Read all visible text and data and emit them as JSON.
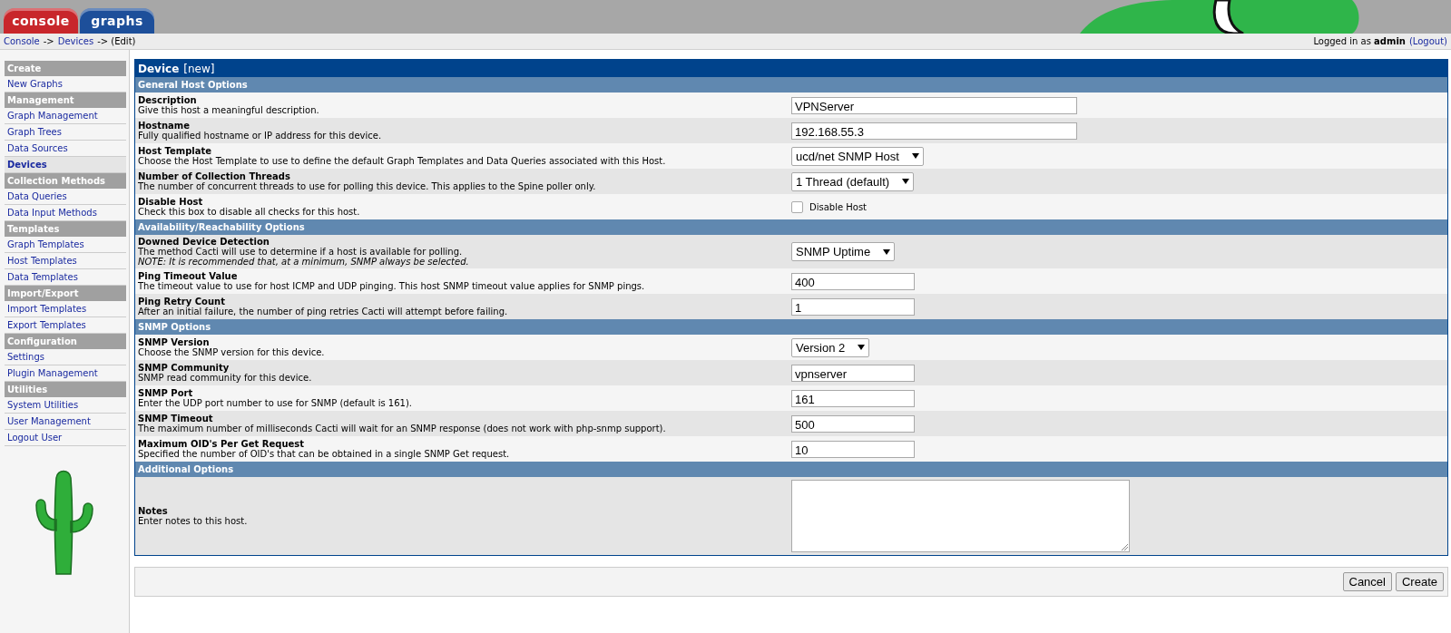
{
  "header": {
    "tabs": [
      {
        "label": "console",
        "color": "#c8262b"
      },
      {
        "label": "graphs",
        "color": "#1d4f9a"
      }
    ]
  },
  "breadcrumb": [
    {
      "label": "Console",
      "kind": "link"
    },
    {
      "label": "->",
      "kind": "text"
    },
    {
      "label": "Devices",
      "kind": "link"
    },
    {
      "label": "-> (Edit)",
      "kind": "text"
    }
  ],
  "user_status": {
    "text": "Logged in as **admin**",
    "link": "(Logout)"
  },
  "sidebar": [
    {
      "title": "Create",
      "items": [
        {
          "label": "New Graphs",
          "selected": false
        }
      ]
    },
    {
      "title": "Management",
      "items": [
        {
          "label": "Graph Management",
          "selected": false
        },
        {
          "label": "Graph Trees",
          "selected": false
        },
        {
          "label": "Data Sources",
          "selected": false
        },
        {
          "label": "Devices",
          "selected": true
        }
      ]
    },
    {
      "title": "Collection Methods",
      "items": [
        {
          "label": "Data Queries",
          "selected": false
        },
        {
          "label": "Data Input Methods",
          "selected": false
        }
      ]
    },
    {
      "title": "Templates",
      "items": [
        {
          "label": "Graph Templates",
          "selected": false
        },
        {
          "label": "Host Templates",
          "selected": false
        },
        {
          "label": "Data Templates",
          "selected": false
        }
      ]
    },
    {
      "title": "Import/Export",
      "items": [
        {
          "label": "Import Templates",
          "selected": false
        },
        {
          "label": "Export Templates",
          "selected": false
        }
      ]
    },
    {
      "title": "Configuration",
      "items": [
        {
          "label": "Settings",
          "selected": false
        },
        {
          "label": "Plugin Management",
          "selected": false
        }
      ]
    },
    {
      "title": "Utilities",
      "items": [
        {
          "label": "System Utilities",
          "selected": false
        },
        {
          "label": "User Management",
          "selected": false
        },
        {
          "label": "Logout User",
          "selected": false
        }
      ]
    }
  ],
  "form": {
    "title": "Device",
    "subtitle": "[new]",
    "sections": [
      {
        "title": "General Host Options",
        "rows": [
          {
            "kind": "textbox",
            "title": "Description",
            "description": "Give this host a meaningful description.",
            "value": "VPNServer"
          },
          {
            "kind": "textbox",
            "title": "Hostname",
            "description": "Fully qualified hostname or IP address for this device.",
            "value": "192.168.55.3"
          },
          {
            "kind": "dropdown",
            "title": "Host Template",
            "description": "Choose the Host Template to use to define the default Graph Templates and Data Queries associated with this Host.",
            "value": "ucd/net SNMP Host"
          },
          {
            "kind": "dropdown",
            "title": "Number of Collection Threads",
            "description": "The number of concurrent threads to use for polling this device. This applies to the Spine poller only.",
            "value": "1 Thread (default)"
          },
          {
            "kind": "checkbox",
            "title": "Disable Host",
            "description": "Check this box to disable all checks for this host.",
            "label": "Disable Host",
            "checked": false
          }
        ]
      },
      {
        "title": "Availability/Reachability Options",
        "rows": [
          {
            "kind": "dropdown",
            "title": "Downed Device Detection",
            "description": "The method Cacti will use to determine if a host is available for polling.",
            "note": "NOTE: It is recommended that, at a minimum, SNMP always be selected.",
            "value": "SNMP Uptime"
          },
          {
            "kind": "shortbox",
            "title": "Ping Timeout Value",
            "description": "The timeout value to use for host ICMP and UDP pinging. This host SNMP timeout value applies for SNMP pings.",
            "value": "400"
          },
          {
            "kind": "shortbox",
            "title": "Ping Retry Count",
            "description": "After an initial failure, the number of ping retries Cacti will attempt before failing.",
            "value": "1"
          }
        ]
      },
      {
        "title": "SNMP Options",
        "rows": [
          {
            "kind": "dropdown",
            "title": "SNMP Version",
            "description": "Choose the SNMP version for this device.",
            "value": "Version 2"
          },
          {
            "kind": "shortbox",
            "title": "SNMP Community",
            "description": "SNMP read community for this device.",
            "value": "vpnserver"
          },
          {
            "kind": "shortbox",
            "title": "SNMP Port",
            "description": "Enter the UDP port number to use for SNMP (default is 161).",
            "value": "161"
          },
          {
            "kind": "shortbox",
            "title": "SNMP Timeout",
            "description": "The maximum number of milliseconds Cacti will wait for an SNMP response (does not work with php-snmp support).",
            "value": "500"
          },
          {
            "kind": "shortbox",
            "title": "Maximum OID's Per Get Request",
            "description": "Specified the number of OID's that can be obtained in a single SNMP Get request.",
            "value": "10"
          }
        ]
      },
      {
        "title": "Additional Options",
        "rows": [
          {
            "kind": "textarea",
            "title": "Notes",
            "description": "Enter notes to this host."
          }
        ]
      }
    ]
  },
  "buttons": [
    "Cancel",
    "Create"
  ]
}
